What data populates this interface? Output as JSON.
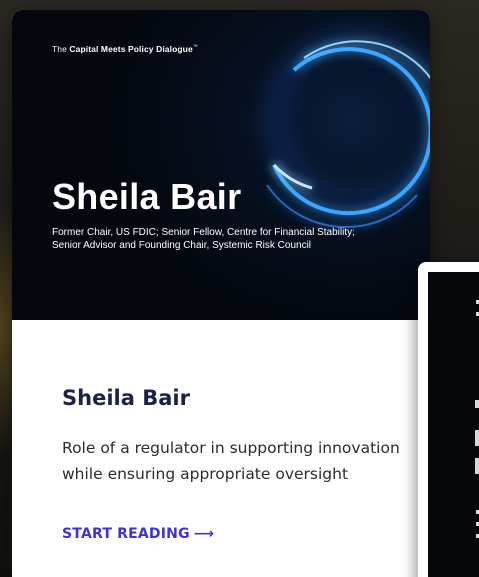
{
  "hero": {
    "brand_prefix": "The",
    "brand_name": "Capital Meets Policy Dialogue",
    "brand_tm": "™",
    "name": "Sheila Bair",
    "description": "Former Chair, US FDIC; Senior Fellow, Centre for Financial Stability; Senior Advisor and Founding Chair, Systemic Risk Council"
  },
  "content": {
    "name": "Sheila Bair",
    "description": "Role of a regulator in supporting innovation while ensuring appropriate oversight",
    "cta_label": "START READING",
    "cta_arrow": "⟶"
  },
  "colors": {
    "title": "#1d2147",
    "cta": "#3d33d6",
    "hero_bg": "#04070d",
    "ring_glow": "#3aa6ff"
  },
  "icons": {
    "cta": "arrow-right-icon"
  }
}
